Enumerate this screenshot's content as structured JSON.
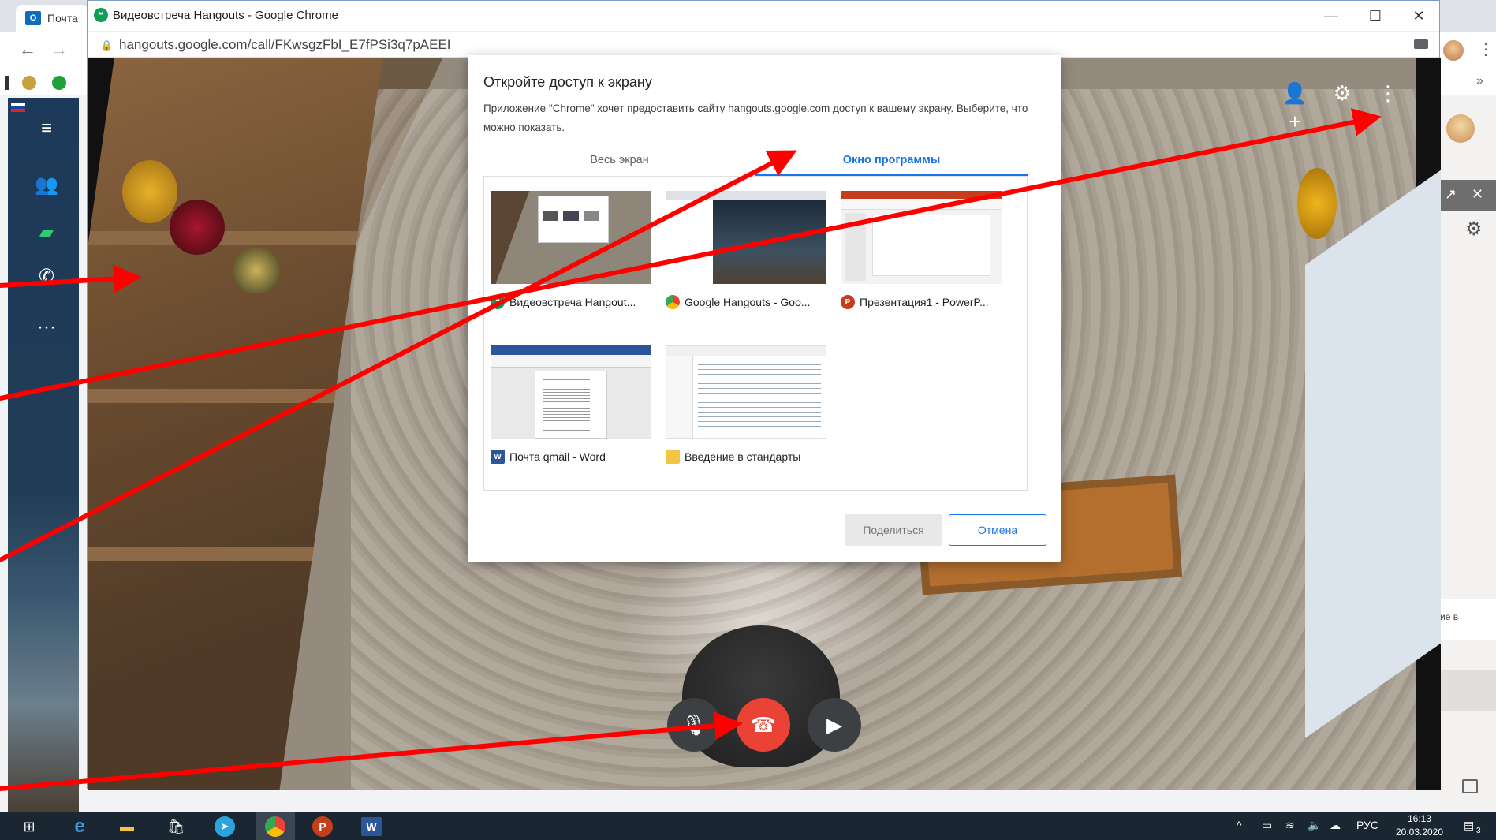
{
  "background_window": {
    "tab_title": "Почта",
    "outlook_logo": "O",
    "right_panel_text": "ие в"
  },
  "hangouts_window": {
    "title": "Видеовстреча Hangouts - Google Chrome",
    "url": "hangouts.google.com/call/FKwsgzFbI_E7fPSi3q7pAEEI",
    "window_buttons": [
      "—",
      "☐",
      "✕"
    ]
  },
  "dialog": {
    "title": "Откройте доступ к экрану",
    "description": "Приложение \"Chrome\" хочет предоставить сайту hangouts.google.com доступ к вашему экрану. Выберите, что можно показать.",
    "tabs": [
      {
        "label": "Весь экран",
        "active": false
      },
      {
        "label": "Окно программы",
        "active": true
      }
    ],
    "windows": [
      {
        "label": "Видеовстреча Hangout...",
        "icon": "hangouts-icon"
      },
      {
        "label": "Google Hangouts - Goo...",
        "icon": "chrome-icon"
      },
      {
        "label": "Презентация1 - PowerP...",
        "icon": "powerpoint-icon"
      },
      {
        "label": "Почта qmail - Word",
        "icon": "word-icon"
      },
      {
        "label": "Введение в стандарты",
        "icon": "folder-icon"
      }
    ],
    "share_button": "Поделиться",
    "cancel_button": "Отмена"
  },
  "call_controls": {
    "mic": "mic-icon",
    "hangup": "hangup-icon",
    "camera": "camera-icon"
  },
  "taskbar": {
    "language": "РУС",
    "time": "16:13",
    "date": "20.03.2020",
    "notification_count": "3",
    "apps": [
      "start-icon",
      "edge-icon",
      "explorer-icon",
      "store-icon",
      "telegram-icon",
      "chrome-icon",
      "powerpoint-icon",
      "word-icon"
    ]
  },
  "colors": {
    "accent": "#1a73e8",
    "hangup": "#ea4335",
    "arrow": "#ff0000"
  }
}
